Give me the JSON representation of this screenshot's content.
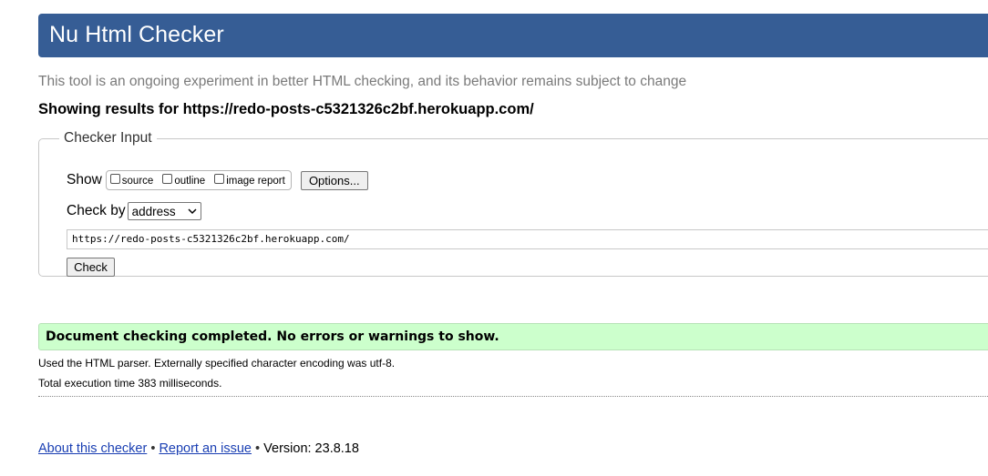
{
  "header": {
    "title": "Nu Html Checker"
  },
  "tagline": "This tool is an ongoing experiment in better HTML checking, and its behavior remains subject to change",
  "results_title": "Showing results for https://redo-posts-c5321326c2bf.herokuapp.com/",
  "checker_input": {
    "legend": "Checker Input",
    "show_label": "Show",
    "show_options": [
      {
        "label": "source",
        "checked": false
      },
      {
        "label": "outline",
        "checked": false
      },
      {
        "label": "image report",
        "checked": false
      }
    ],
    "options_button": "Options...",
    "check_by_label": "Check by",
    "check_by_value": "address",
    "url_value": "https://redo-posts-c5321326c2bf.herokuapp.com/",
    "check_button": "Check"
  },
  "status": {
    "message": "Document checking completed. No errors or warnings to show.",
    "color": "#ccffcc"
  },
  "details": {
    "parser": "Used the HTML parser. Externally specified character encoding was utf-8.",
    "execution_time": "Total execution time 383 milliseconds."
  },
  "footer": {
    "about_link": "About this checker",
    "separator": "•",
    "report_link": "Report an issue",
    "version": "Version: 23.8.18"
  },
  "colors": {
    "header_bg": "#365d95",
    "link": "#1a3fb3"
  }
}
